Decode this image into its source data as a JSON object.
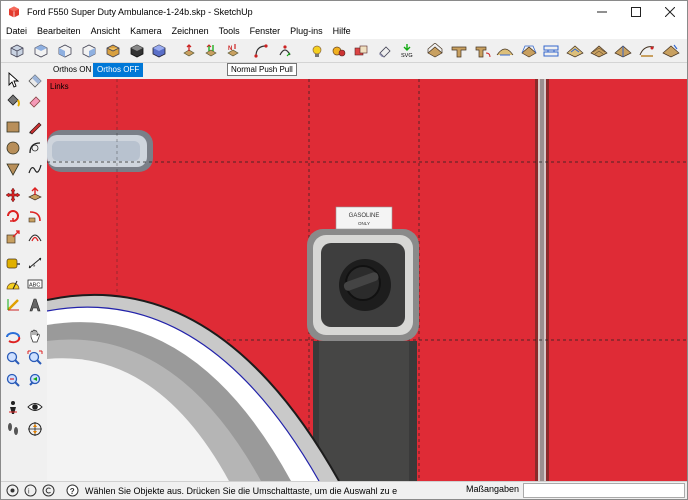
{
  "window": {
    "title": "Ford F550 Super Duty Ambulance-1-24b.skp - SketchUp",
    "controls": [
      "minimize",
      "maximize",
      "close"
    ]
  },
  "menu": {
    "items": [
      "Datei",
      "Bearbeiten",
      "Ansicht",
      "Kamera",
      "Zeichnen",
      "Tools",
      "Fenster",
      "Plug-ins",
      "Hilfe"
    ]
  },
  "toolbar": {
    "orthos_on": "Orthos ON",
    "orthos_off": "Orthos OFF",
    "tooltip": "Normal Push Pull",
    "svg_label": "SVG"
  },
  "viewport": {
    "scene_label": "Links",
    "decal_text_1": "GASOLINE",
    "decal_text_2": "ONLY",
    "background_color": "#dd2a35"
  },
  "status": {
    "message": "Wählen Sie Objekte aus. Drücken Sie die Umschalttaste, um die Auswahl zu e",
    "measure_label": "Maßangaben",
    "measure_value": ""
  },
  "icons": {
    "left": [
      "select-arrow-icon",
      "eraser-icon",
      "paint-bucket-icon",
      "erase-pink-icon",
      "rectangle-icon",
      "pencil-icon",
      "circle-icon",
      "arc-icon",
      "polygon-icon",
      "freehand-icon",
      "move-icon",
      "push-pull-icon",
      "rotate-icon",
      "follow-me-icon",
      "scale-icon",
      "offset-icon",
      "tape-measure-icon",
      "dimension-icon",
      "protractor-icon",
      "text-icon",
      "axes-icon",
      "3d-text-icon",
      "orbit-icon",
      "pan-icon",
      "zoom-icon",
      "zoom-window-icon",
      "zoom-extents-icon",
      "previous-view-icon",
      "position-camera-icon",
      "look-around-icon",
      "walk-icon",
      "section-plane-icon"
    ]
  }
}
